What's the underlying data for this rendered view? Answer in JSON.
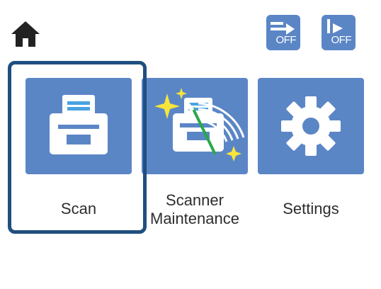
{
  "header": {
    "home_icon": "home-icon",
    "status_buttons": [
      {
        "icon": "data-transfer-off-icon",
        "label": "OFF"
      },
      {
        "icon": "auto-feed-off-icon",
        "label": "OFF"
      }
    ]
  },
  "menu": {
    "tiles": [
      {
        "label": "Scan",
        "icon": "scanner-icon",
        "selected": true
      },
      {
        "label_line1": "Scanner",
        "label_line2": "Maintenance",
        "icon": "scanner-cleaning-icon",
        "selected": false
      },
      {
        "label": "Settings",
        "icon": "gear-icon",
        "selected": false
      }
    ]
  },
  "colors": {
    "tile_blue": "#5b86c6",
    "focus_ring": "#1f4f7f",
    "background": "#ffffff"
  }
}
